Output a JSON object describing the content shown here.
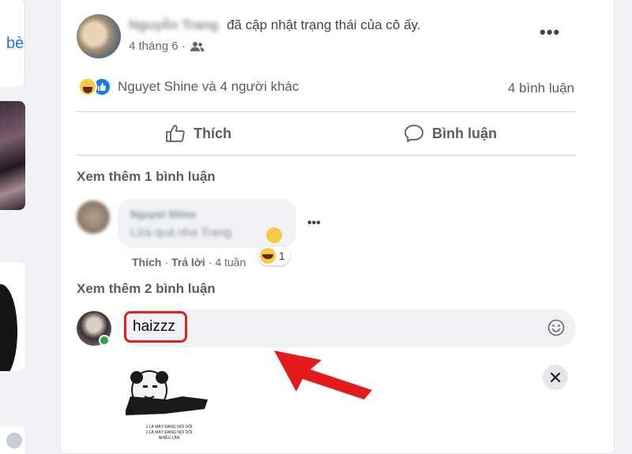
{
  "left_column": {
    "link_text": "bè"
  },
  "post": {
    "author": "Nguyễn Trang",
    "action_text": "đã cập nhật trạng thái của cô ấy.",
    "date": "4 tháng 6 ·",
    "privacy_icon": "friends-icon",
    "reactions_text": "Nguyet Shine và 4 người khác",
    "comment_count": "4 bình luận",
    "like_label": "Thích",
    "comment_label": "Bình luận",
    "view_more_1": "Xem thêm 1 bình luận",
    "view_more_2": "Xem thêm 2 bình luận",
    "comment": {
      "author": "Nguyet Shine",
      "text": "Lừa quá nha Trang",
      "like": "Thích",
      "reply": "Trả lời",
      "time": "4 tuần",
      "reaction_count": "1"
    },
    "composer": {
      "value": "haizzz",
      "sticker_caption_1": "1 LÀ MÀY ĐANG NÓI DỐI",
      "sticker_caption_2": "2 LÀ MÀY ĐANG NÓI DỐI",
      "sticker_caption_3": "NHIỀU LẦN"
    }
  },
  "colors": {
    "highlight": "#e22020",
    "facebook_blue": "#1877f2",
    "online": "#31a24c"
  }
}
